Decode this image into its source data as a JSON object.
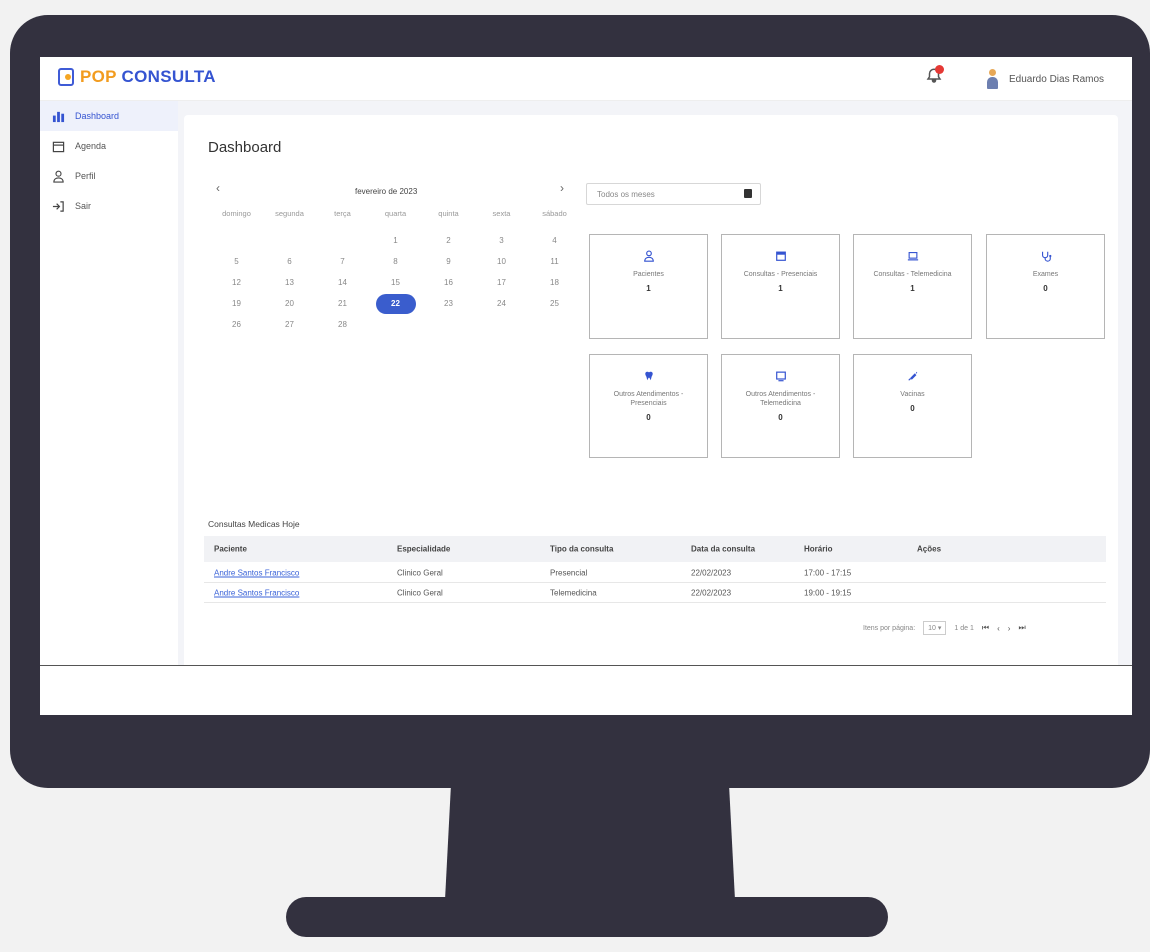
{
  "app": {
    "logo_pop": "POP",
    "logo_consulta": "CONSULTA",
    "user_name": "Eduardo Dias Ramos",
    "colors": {
      "brand_blue": "#3554d1",
      "brand_orange": "#f29c1f",
      "frame": "#33313f"
    }
  },
  "sidebar": {
    "items": [
      {
        "label": "Dashboard",
        "icon": "bar-chart-icon"
      },
      {
        "label": "Agenda",
        "icon": "calendar-icon"
      },
      {
        "label": "Perfil",
        "icon": "person-icon"
      },
      {
        "label": "Sair",
        "icon": "logout-icon"
      }
    ]
  },
  "page": {
    "title": "Dashboard"
  },
  "calendar": {
    "prev": "‹",
    "next": "›",
    "month": "fevereiro de 2023",
    "weekdays": [
      "domingo",
      "segunda",
      "terça",
      "quarta",
      "quinta",
      "sexta",
      "sábado"
    ],
    "weeks": [
      [
        "",
        "",
        "",
        "1",
        "2",
        "3",
        "4"
      ],
      [
        "5",
        "6",
        "7",
        "8",
        "9",
        "10",
        "11"
      ],
      [
        "12",
        "13",
        "14",
        "15",
        "16",
        "17",
        "18"
      ],
      [
        "19",
        "20",
        "21",
        "22",
        "23",
        "24",
        "25"
      ],
      [
        "26",
        "27",
        "28",
        "",
        "",
        "",
        ""
      ]
    ],
    "selected": "22"
  },
  "filter": {
    "placeholder": "Todos os meses"
  },
  "stats": [
    {
      "label": "Pacientes",
      "value": "1",
      "icon": "person-icon"
    },
    {
      "label": "Consultas - Presenciais",
      "value": "1",
      "icon": "calendar-icon"
    },
    {
      "label": "Consultas - Telemedicina",
      "value": "1",
      "icon": "laptop-icon"
    },
    {
      "label": "Exames",
      "value": "0",
      "icon": "stethoscope-icon"
    },
    {
      "label": "Outros Atendimentos - Presenciais",
      "value": "0",
      "icon": "tooth-icon"
    },
    {
      "label": "Outros Atendimentos - Telemedicina",
      "value": "0",
      "icon": "monitor-icon"
    },
    {
      "label": "Vacinas",
      "value": "0",
      "icon": "syringe-icon"
    }
  ],
  "table": {
    "title": "Consultas Medicas Hoje",
    "headers": [
      "Paciente",
      "Especialidade",
      "Tipo da consulta",
      "Data da consulta",
      "Horário",
      "Ações"
    ],
    "rows": [
      [
        "Andre Santos Francisco",
        "Clinico Geral",
        "Presencial",
        "22/02/2023",
        "17:00 - 17:15"
      ],
      [
        "Andre Santos Francisco",
        "Clinico Geral",
        "Telemedicina",
        "22/02/2023",
        "19:00 - 19:15"
      ]
    ]
  },
  "pager": {
    "items_label": "Itens por página:",
    "page_size": "10",
    "range": "1 de 1",
    "first": "⏮",
    "prev": "‹",
    "next": "›",
    "last": "⏭"
  }
}
